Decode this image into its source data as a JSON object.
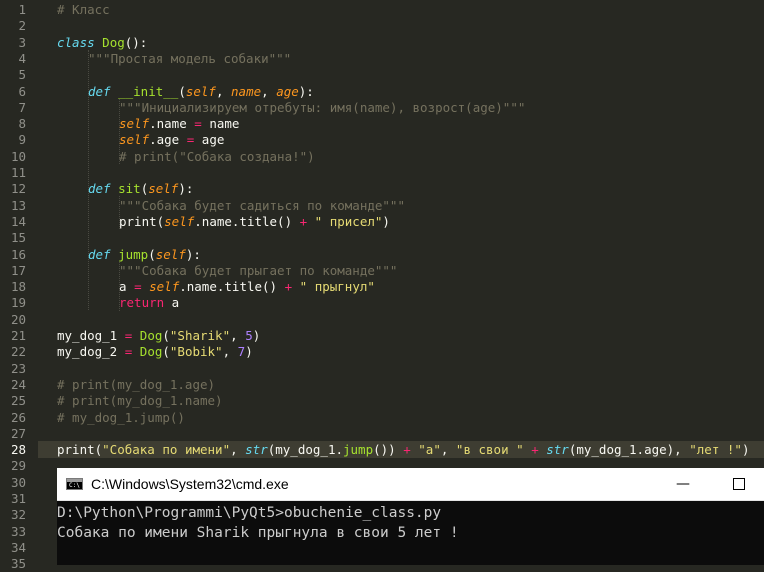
{
  "editor": {
    "active_line": 28,
    "line_numbers": [
      "1",
      "2",
      "3",
      "4",
      "5",
      "6",
      "7",
      "8",
      "9",
      "10",
      "11",
      "12",
      "13",
      "14",
      "15",
      "16",
      "17",
      "18",
      "19",
      "20",
      "21",
      "22",
      "23",
      "24",
      "25",
      "26",
      "27",
      "28",
      "29",
      "30",
      "31",
      "32",
      "33",
      "34",
      "35"
    ],
    "code": {
      "l1_comment": "# Класс",
      "l3_kw": "class",
      "l3_name": "Dog",
      "l3_rest": "():",
      "l4_doc": "\"\"\"Простая модель собаки\"\"\"",
      "l6_kw": "def",
      "l6_name": "__init__",
      "l6_open": "(",
      "l6_p1": "self",
      "l6_sep1": ", ",
      "l6_p2": "name",
      "l6_sep2": ", ",
      "l6_p3": "age",
      "l6_close": "):",
      "l7_doc": "\"\"\"Инициализируем отребуты: имя(name), возрост(age)\"\"\"",
      "l8_self": "self",
      "l8_attr": ".name ",
      "l8_op": "=",
      "l8_val": " name",
      "l9_self": "self",
      "l9_attr": ".age ",
      "l9_op": "=",
      "l9_val": " age",
      "l10_comment": "# print(\"Собака создана!\")",
      "l13_kw": "def",
      "l13_name": "sit",
      "l13_open": "(",
      "l13_p1": "self",
      "l13_close": "):",
      "l14_doc": "\"\"\"Собака будет садиться по команде\"\"\"",
      "l15_print": "print(",
      "l15_self": "self",
      "l15_mid": ".name.title() ",
      "l15_op": "+",
      "l15_str": " \" присел\"",
      "l15_close": ")",
      "l17_kw": "def",
      "l17_name": "jump",
      "l17_open": "(",
      "l17_p1": "self",
      "l17_close": "):",
      "l18_doc": "\"\"\"Собака будет прыгает по команде\"\"\"",
      "l19_var": "a ",
      "l19_op1": "=",
      "l19_sp": " ",
      "l19_self": "self",
      "l19_mid": ".name.title() ",
      "l19_op2": "+",
      "l19_str": " \" прыгнул\"",
      "l20_kw": "return",
      "l20_val": " a",
      "l22_var": "my_dog_1 ",
      "l22_op": "=",
      "l22_sp": " ",
      "l22_cls": "Dog",
      "l22_open": "(",
      "l22_str": "\"Sharik\"",
      "l22_sep": ", ",
      "l22_num": "5",
      "l22_close": ")",
      "l23_var": "my_dog_2 ",
      "l23_op": "=",
      "l23_sp": " ",
      "l23_cls": "Dog",
      "l23_open": "(",
      "l23_str": "\"Bobik\"",
      "l23_sep": ", ",
      "l23_num": "7",
      "l23_close": ")",
      "l25_comment": "# print(my_dog_1.age)",
      "l26_comment": "# print(my_dog_1.name)",
      "l27_comment": "# my_dog_1.jump()",
      "l29_a": "print(",
      "l29_b": "\"Собака по имени\"",
      "l29_c": ", ",
      "l29_d": "str",
      "l29_e": "(my_dog_1.",
      "l29_f": "jump",
      "l29_g": "()) ",
      "l29_h": "+",
      "l29_i": " ",
      "l29_j": "\"а\"",
      "l29_k": ", ",
      "l29_l": "\"в свои \"",
      "l29_m": " ",
      "l29_n": "+",
      "l29_o": " ",
      "l29_p": "str",
      "l29_q": "(my_dog_1.age), ",
      "l29_r": "\"лет !\"",
      "l29_s": ")"
    }
  },
  "cmd": {
    "title": "C:\\Windows\\System32\\cmd.exe",
    "min_symbol": "—",
    "prompt_glyph": "C:\\",
    "output": [
      "D:\\Python\\Programmi\\PyQt5>obuchenie_class.py",
      "Собака по имени Sharik прыгнула в свои 5 лет !"
    ]
  },
  "colors": {
    "background": "#272822",
    "comment": "#75715e",
    "keyword": "#66d9ef",
    "function": "#a6e22e",
    "param": "#fd971f",
    "string": "#e6db74",
    "operator": "#f92672",
    "number": "#ae81ff",
    "console_bg": "#0c0c0c",
    "console_text": "#cccccc"
  }
}
